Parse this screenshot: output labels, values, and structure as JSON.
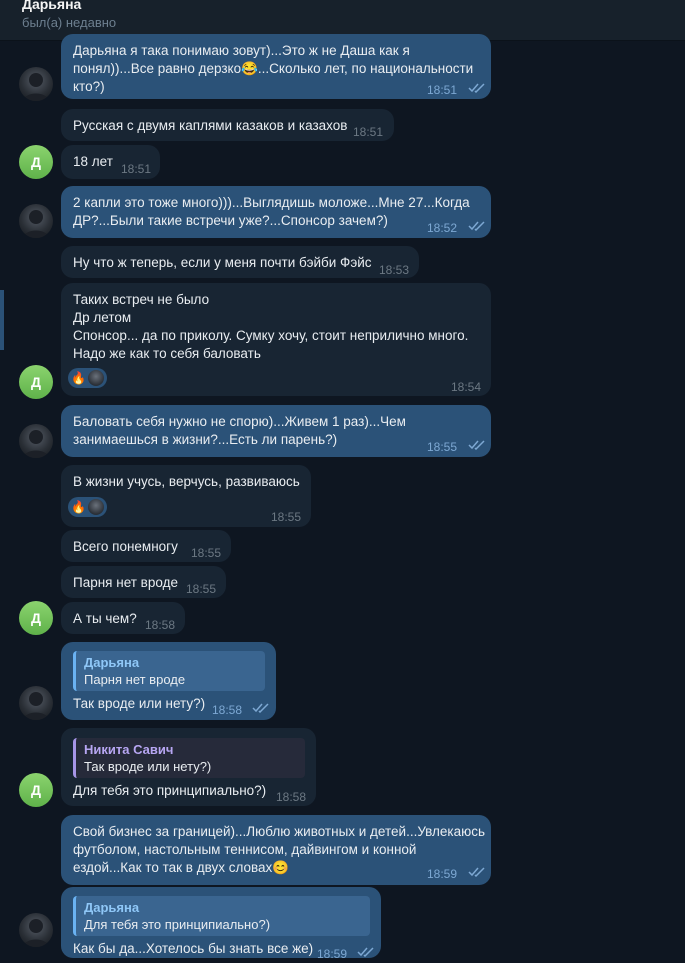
{
  "header": {
    "contact_name": "Дарьяна",
    "status": "был(а) недавно"
  },
  "messages": [
    {
      "text": "Дарьяна я така понимаю зовут)...Это ж не Даша как я\nпонял))...Все равно дерзко😂...Сколько лет, по национальности\nкто?)",
      "time": "18:51"
    },
    {
      "text": "Русская с двумя каплями казаков и казахов",
      "time": "18:51"
    },
    {
      "text": "18 лет",
      "time": "18:51"
    },
    {
      "text": "2 капли это тоже много)))...Выглядишь моложе...Мне 27...Когда\nДР?...Были такие встречи уже?...Спонсор зачем?)",
      "time": "18:52"
    },
    {
      "text": "Ну что ж теперь, если у меня почти бэйби Фэйс",
      "time": "18:53"
    },
    {
      "text": "Таких встреч не было\nДр летом\nСпонсор... да по приколу.  Сумку хочу, стоит неприлично много.\nНадо же как то себя баловать",
      "time": "18:54"
    },
    {
      "text": "Баловать себя нужно не спорю)...Живем 1 раз)...Чем\nзанимаешься в жизни?...Есть ли парень?)",
      "time": "18:55"
    },
    {
      "text": "В жизни учусь, верчусь, развиваюсь",
      "time": "18:55"
    },
    {
      "text": "Всего понемногу",
      "time": "18:55"
    },
    {
      "text": "Парня нет вроде",
      "time": "18:55"
    },
    {
      "text": "А ты чем?",
      "time": "18:58"
    },
    {
      "text": "Так вроде или нету?)",
      "time": "18:58",
      "reply_name": "Дарьяна",
      "reply_text": "Парня нет вроде"
    },
    {
      "text": "Для тебя это принципиально?)",
      "time": "18:58",
      "reply_name": "Никита Савич",
      "reply_text": "Так вроде или нету?)"
    },
    {
      "text": "Свой бизнес за границей)...Люблю животных и детей...Увлекаюсь\nфутболом, настольным теннисом, дайвингом и конной\nездой...Как то так в двух словах😊",
      "time": "18:59"
    },
    {
      "text": "Как бы да...Хотелось бы знать все же)",
      "time": "18:59",
      "reply_name": "Дарьяна",
      "reply_text": "Для тебя это принципиально?)"
    }
  ],
  "avatar_letter": "Д",
  "reaction_emoji": "🔥",
  "colors": {
    "bg": "#0e1621",
    "bubble_in": "#182533",
    "bubble_out": "#2b5278",
    "accent": "#6ab2f2"
  }
}
